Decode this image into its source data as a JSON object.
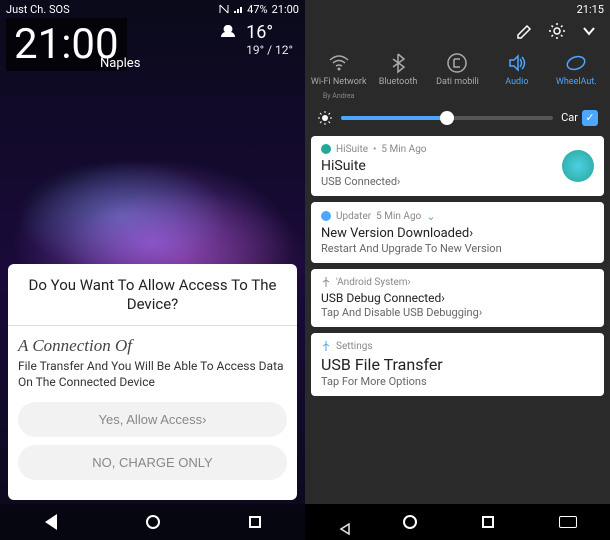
{
  "left": {
    "status": {
      "carrier": "Just Ch. SOS",
      "battery": "47%",
      "time_small": "21:00"
    },
    "clock": "21:00",
    "location": "Naples",
    "weather": {
      "temp": "16°",
      "range": "19° / 12°"
    },
    "dialog": {
      "title": "Do You Want To Allow Access To The Device?",
      "subtitle": "A Connection Of",
      "body": "File Transfer And You Will Be Able To Access Data On The Connected Device",
      "allow_btn": "Yes, Allow Access›",
      "deny_btn": "NO, CHARGE ONLY"
    }
  },
  "right": {
    "status": {
      "time": "21:15"
    },
    "qs": {
      "wifi": {
        "label": "Wi-Fi Network",
        "sub": "By Andrea"
      },
      "bluetooth": {
        "label": "Bluetooth"
      },
      "data": {
        "label": "Dati mobili"
      },
      "audio": {
        "label": "Audio"
      },
      "rotate": {
        "label": "WheelAut."
      }
    },
    "car_label": "Car",
    "notifs": [
      {
        "app": "HiSuite",
        "time": "5 Min Ago",
        "title": "HiSuite",
        "body": "USB Connected›",
        "icon_color": "#4dd0e1",
        "has_globe": true
      },
      {
        "app": "Updater",
        "time": "5 Min Ago",
        "title": "New Version Downloaded›",
        "body": "Restart And Upgrade To New Version",
        "icon_color": "#4da6ff",
        "expandable": true
      },
      {
        "app": "'Android System›",
        "title": "USB Debug Connected›",
        "body": "Tap And Disable USB Debugging›",
        "icon_color": "#888"
      },
      {
        "app": "Settings",
        "title": "USB File Transfer",
        "body": "Tap For More Options",
        "icon_color": "#4da6ff",
        "big_title": true
      }
    ]
  }
}
